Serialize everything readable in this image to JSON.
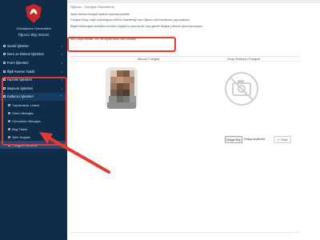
{
  "sidebar": {
    "university_name": "Gümüşhane Üniversitesi",
    "system_title": "Öğrenci Bilgi Sistemi",
    "items": [
      {
        "label": "Genel İşlemler",
        "icon": "square-icon",
        "arrow": "›"
      },
      {
        "label": "Ders ve Dönem İşlemleri",
        "icon": "square-icon",
        "arrow": "›"
      },
      {
        "label": "Form İşlemleri",
        "icon": "square-icon",
        "arrow": "›"
      },
      {
        "label": "İlişik Kesme Talebi",
        "icon": "square-icon",
        "arrow": "›"
      },
      {
        "label": "Hazırlık İşlemleri",
        "icon": "square-icon",
        "arrow": "›"
      },
      {
        "label": "Başvuru İşlemleri",
        "icon": "square-icon",
        "arrow": "›"
      },
      {
        "label": "Kullanıcı İşlemleri",
        "icon": "square-icon",
        "arrow": "⌃",
        "open": true
      }
    ],
    "sub_items": [
      {
        "label": "Yapılacaklar Listesi"
      },
      {
        "label": "Gelen Mesajlar"
      },
      {
        "label": "Gönderilen Mesajlar"
      },
      {
        "label": "Bilgi Talebi"
      },
      {
        "label": "Şifre Değiştir"
      },
      {
        "label": "Fotoğraf Güncelle",
        "active": true
      }
    ]
  },
  "content": {
    "breadcrumb": "Öğrenci - Fotoğraf Güncelleme",
    "info_line_1": "Zaten eklenen fotoğraf nedenle sonunda yönetilir.",
    "info_line_2": "Fotoğraf Onayı, bağlı bulunduğunuz Bölüm Sekreterliği veya Öğrenci İşleri tarafından yapılmaktadır.",
    "info_line_3": "Bilgileriniz/fotoğrafı kesinlikle mümkün olduğunca sonuçlarıdır onay gerekli fotoğraf yükleme işlemi tamamlanır.",
    "warning_text": "Not: Dosya formatı .JPG ve boyutu fazla 2MB olmalıdır.",
    "label_current": "Mevcut Fotoğraf",
    "label_new": "Onay Bekleyen Fotoğraf",
    "file_button_label": "Dosya Seç",
    "file_status": "Dosya seçilmedi",
    "upload_label": "Yükle",
    "upload_icon": "upload-icon"
  },
  "colors": {
    "sidebar_bg": "#0f2c4a",
    "annotation": "#e23b32"
  }
}
